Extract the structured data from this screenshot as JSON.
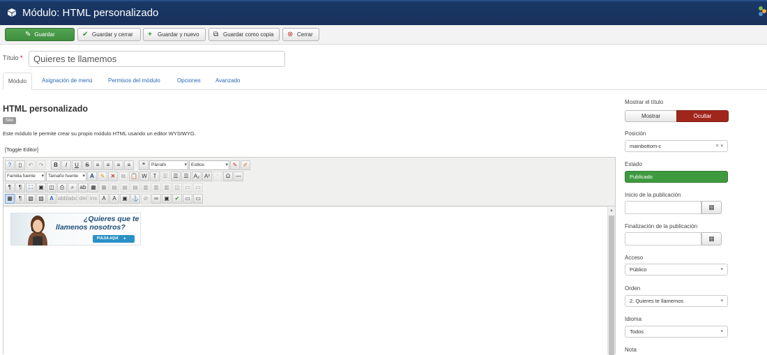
{
  "header": {
    "title": "Módulo: HTML personalizado",
    "icon": "cube-icon"
  },
  "toolbar": {
    "save": "Guardar",
    "save_close": "Guardar y cerrar",
    "save_new": "Guardar y nuevo",
    "save_copy": "Guardar como copia",
    "close": "Cerrar"
  },
  "title_field": {
    "label": "Título",
    "required_mark": "*",
    "value": "Quieres te llamemos"
  },
  "tabs": [
    {
      "label": "Módulo",
      "active": true
    },
    {
      "label": "Asignación de menú"
    },
    {
      "label": "Permisos del módulo"
    },
    {
      "label": "Opciones"
    },
    {
      "label": "Avanzado"
    }
  ],
  "module": {
    "heading": "HTML personalizado",
    "badge": "Sitio",
    "description": "Este módulo le permite crear su propio módulo HTML usando un editor WYSIWYG.",
    "toggle": "[Toggle Editor]"
  },
  "editor": {
    "format_select": "Párrafo",
    "styles_select": "Estilos",
    "font_family_select": "Familia fuente",
    "font_size_select": "Tamaño fuente",
    "content_banner": {
      "line1": "¿Quieres que  te",
      "line2": "llamenos nosotros?",
      "button": "PULSA AQUÍ"
    }
  },
  "sidebar": {
    "show_title": {
      "label": "Mostrar el título",
      "show": "Mostrar",
      "hide": "Ocultar",
      "selected": "Ocultar"
    },
    "position": {
      "label": "Posición",
      "value": "mainbottom-c"
    },
    "status": {
      "label": "Estado",
      "value": "Publicado"
    },
    "publish_up": {
      "label": "Inicio de la publicación",
      "value": ""
    },
    "publish_down": {
      "label": "Finalización de la publicación",
      "value": ""
    },
    "access": {
      "label": "Acceso",
      "value": "Público"
    },
    "ordering": {
      "label": "Orden",
      "value": "2. Quieres te llamemos"
    },
    "language": {
      "label": "Idioma",
      "value": "Todos"
    },
    "note": {
      "label": "Nota"
    }
  },
  "colors": {
    "header_bg": "#17315a",
    "save_green": "#468f46",
    "hide_red": "#a0261c",
    "status_green": "#3f9a3f",
    "link_blue": "#2a69b8"
  }
}
